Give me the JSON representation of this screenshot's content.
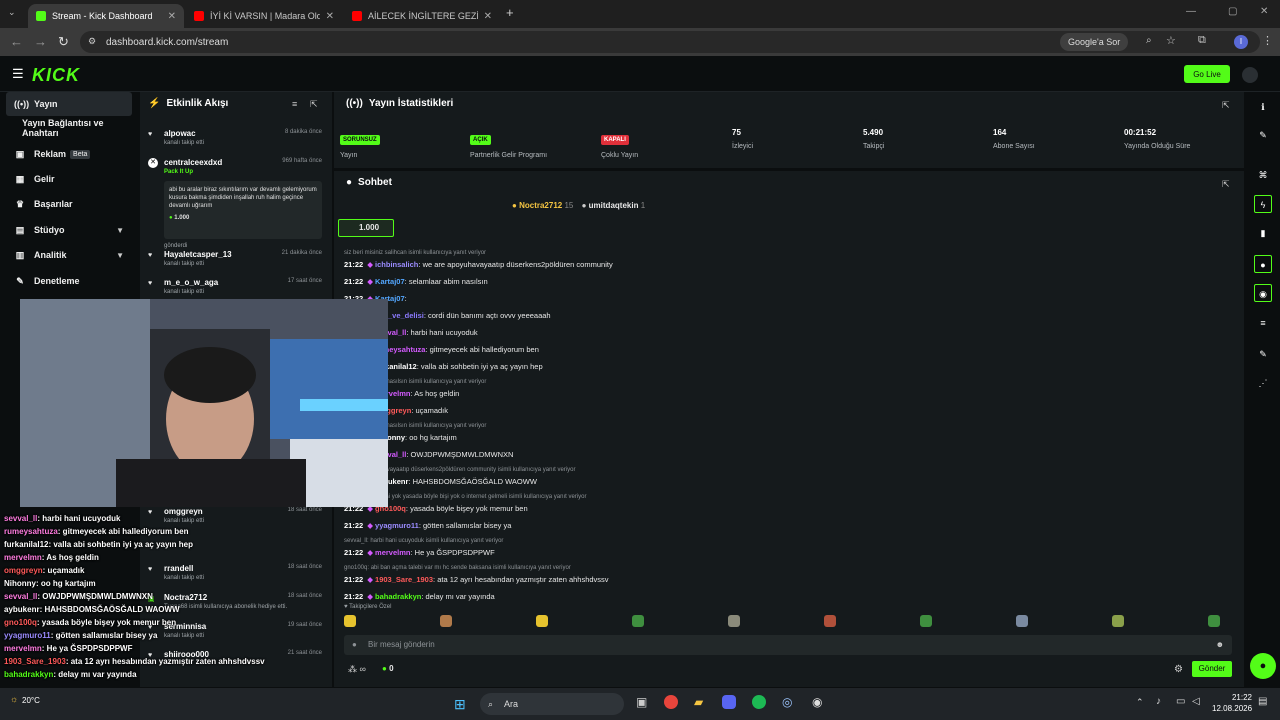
{
  "browser": {
    "tabs": [
      {
        "label": "Stream - Kick Dashboard",
        "active": true
      },
      {
        "label": "İYİ Kİ VARSIN | Madara Olduk #",
        "active": false
      },
      {
        "label": "AİLECEK İNGİLTERE GEZİSİ VLO",
        "active": false
      }
    ],
    "url": "dashboard.kick.com/stream",
    "google_label": "Google'a Sor",
    "profile_initial": "I"
  },
  "header": {
    "logo": "KICK",
    "go_live": "Go Live"
  },
  "sidebar": {
    "items": [
      {
        "label": "Yayın",
        "icon": "broadcast-icon",
        "active": true
      },
      {
        "label": "Yayın Bağlantısı ve Anahtarı",
        "icon": "",
        "active": false
      },
      {
        "label": "Reklam",
        "icon": "ad-icon",
        "beta": "Beta"
      },
      {
        "label": "Gelir",
        "icon": "revenue-icon"
      },
      {
        "label": "Başarılar",
        "icon": "trophy-icon"
      },
      {
        "label": "Stüdyo",
        "icon": "studio-icon",
        "chevron": true
      },
      {
        "label": "Analitik",
        "icon": "chart-icon",
        "chevron": true
      },
      {
        "label": "Denetleme",
        "icon": "wrench-icon"
      }
    ]
  },
  "activity": {
    "title": "Etkinlik Akışı",
    "items": [
      {
        "user": "alpowac",
        "time": "8 dakika önce",
        "sub": "kanalı takip etti"
      },
      {
        "user": "centralceexdxd",
        "time": "969 hafta önce",
        "sub": "Pack It Up",
        "message": "abi bu aralar biraz sıkıntılarım var devamlı gelemiyorum kusura bakma şimdiden inşallah ruh halim geçince devamlı uğrarım",
        "amount": "1.000",
        "footer": "gönderdi"
      },
      {
        "user": "Hayaletcasper_13",
        "time": "21 dakika önce",
        "sub": "kanalı takip etti"
      },
      {
        "user": "m_e_o_w_aga",
        "time": "17 saat önce",
        "sub": "kanalı takip etti"
      },
      {
        "user": "omggreyn",
        "time": "18 saat önce",
        "sub": "kanalı takip etti"
      },
      {
        "user": "rrandell",
        "time": "18 saat önce",
        "sub": "kanalı takip etti"
      },
      {
        "user": "Noctra2712",
        "time": "18 saat önce",
        "sub": "Tuana68 isimli kullanıcıya abonelik hediye etti."
      },
      {
        "user": "serminnisa",
        "time": "19 saat önce",
        "sub": "kanalı takip etti"
      },
      {
        "user": "shiirooo000",
        "time": "21 saat önce",
        "sub": ""
      }
    ]
  },
  "stats": {
    "title": "Yayın İstatistikleri",
    "cards": [
      {
        "badge": "SORUNSUZ",
        "badge_color": "#53fc18",
        "label": "Yayın"
      },
      {
        "badge": "AÇIK",
        "badge_color": "#53fc18",
        "label": "Partnerlik Gelir Programı"
      },
      {
        "badge": "KAPALI",
        "badge_color": "#e0303a",
        "label": "Çoklu Yayın"
      },
      {
        "value": "75",
        "label": "İzleyici"
      },
      {
        "value": "5.490",
        "label": "Takipçi"
      },
      {
        "value": "164",
        "label": "Abone Sayısı"
      },
      {
        "value": "00:21:52",
        "label": "Yayında Olduğu Süre"
      }
    ]
  },
  "chat": {
    "title": "Sohbet",
    "top_gifters": [
      {
        "name": "Noctra2712",
        "count": "15"
      },
      {
        "name": "umitdaqtekin",
        "count": "1"
      }
    ],
    "pinned_amount": "1.000",
    "lines": [
      {
        "reply": "siz beri misiniz salihcan isimli kullanıcıya yanıt veriyor"
      },
      {
        "time": "21:22",
        "user": "ichbinsalich",
        "color": "#9b8cff",
        "text": "we are apoyuhavayaatıp düserkens2pöldüren community"
      },
      {
        "time": "21:22",
        "user": "Kartaj07",
        "color": "#53a7ff",
        "text": "selamlaar abim nasılsın"
      },
      {
        "time": "21:22",
        "user": "Kartaj07",
        "color": "#53a7ff",
        "text": ""
      },
      {
        "time": "21:22",
        "user": "sen_ve_delisi",
        "color": "#8c7bff",
        "text": "cordi dün banımı açtı ovvv yeeeaaah"
      },
      {
        "time": "21:22",
        "user": "sevval_ll",
        "color": "#d45bff",
        "text": "harbi hani ucuyoduk"
      },
      {
        "time": "21:22",
        "user": "rumeysahtuza",
        "color": "#d45bff",
        "text": "gitmeyecek abi hallediyorum ben"
      },
      {
        "time": "21:22",
        "user": "furkanilal12",
        "color": "#ffffff",
        "text": "valla abi sohbetin iyi ya aç yayın hep"
      },
      {
        "reply": "selamlaar abim nasılsın isimli kullanıcıya yanıt veriyor"
      },
      {
        "time": "21:22",
        "user": "mervelmn",
        "color": "#d45bff",
        "text": "As hoş geldin"
      },
      {
        "time": "21:22",
        "user": "omggreyn",
        "color": "#ff5a5a",
        "text": "uçamadık"
      },
      {
        "reply": "selamlaar abim nasılsın isimli kullanıcıya yanıt veriyor"
      },
      {
        "time": "21:22",
        "user": "Nihonny",
        "color": "#ffffff",
        "text": "oo hg kartajım"
      },
      {
        "time": "21:22",
        "user": "sevval_ll",
        "color": "#d45bff",
        "text": "OWJDPWMŞDMWLDMWNXN"
      },
      {
        "reply": "we are apoyuhavayaatıp düserkens2pöldüren community isimli kullanıcıya yanıt veriyor"
      },
      {
        "time": "21:22",
        "user": "aybukenr",
        "color": "#ffffff",
        "text": "HAHSBDOMSĞAÖSĞALD WAOWW"
      },
      {
        "reply": "yasada böyle bişi yok yasada böyle bişi yok o internet gelmeli isimli kullanıcıya yanıt veriyor"
      },
      {
        "time": "21:22",
        "user": "gno100q",
        "color": "#ff5a5a",
        "text": "yasada böyle bişey yok memur ben"
      },
      {
        "time": "21:22",
        "user": "yyagmuro11",
        "color": "#9b8cff",
        "text": "götten sallamıslar bisey ya"
      },
      {
        "reply": "sevval_ll: harbi hani ucuyoduk isimli kullanıcıya yanıt veriyor"
      },
      {
        "time": "21:22",
        "user": "mervelmn",
        "color": "#d45bff",
        "text": "He ya ĞSPDPSDPPWF"
      },
      {
        "reply": "gno100q: abi ban açma talebi var mı hc sende baksana isimli kullanıcıya yanıt veriyor"
      },
      {
        "time": "21:22",
        "user": "1903_Sare_1903",
        "color": "#ff5a5a",
        "text": "ata 12 ayrı hesabından yazmıştır zaten ahhshdvssv"
      },
      {
        "time": "21:22",
        "user": "bahadrakkyn",
        "color": "#53fc18",
        "text": "delay mı var yayında"
      }
    ],
    "emote_label": "Takipçilere Özel",
    "input_placeholder": "Bir mesaj gönderin",
    "send_label": "Gönder",
    "points": "0"
  },
  "overlay_chat": [
    {
      "user": "sevval_ll",
      "color": "#ff7de0",
      "text": ": harbi hani ucuyoduk"
    },
    {
      "user": "rumeysahtuza",
      "color": "#ff7de0",
      "text": ": gitmeyecek abi hallediyorum ben"
    },
    {
      "user": "furkanilal12",
      "color": "#ffffff",
      "text": ": valla abi sohbetin iyi ya aç yayın hep"
    },
    {
      "user": "mervelmn",
      "color": "#ff7de0",
      "text": ": As hoş geldin"
    },
    {
      "user": "omggreyn",
      "color": "#ff5a5a",
      "text": ": uçamadık"
    },
    {
      "user": "Nihonny",
      "color": "#ffffff",
      "text": ": oo hg kartajım"
    },
    {
      "user": "sevval_ll",
      "color": "#ff7de0",
      "text": ": OWJDPWMŞDMWLDMWNXN"
    },
    {
      "user": "aybukenr",
      "color": "#ffffff",
      "text": ": HAHSBDOMSĞAÖSĞALD WAOWW"
    },
    {
      "user": "gno100q",
      "color": "#ff5a5a",
      "text": ": yasada böyle bişey yok memur ben"
    },
    {
      "user": "yyagmuro11",
      "color": "#9b8cff",
      "text": ": götten sallamıslar bisey ya"
    },
    {
      "user": "mervelmn",
      "color": "#ff7de0",
      "text": ": He ya ĞSPDPSDPPWF"
    },
    {
      "user": "1903_Sare_1903",
      "color": "#ff5a5a",
      "text": ": ata 12 ayrı hesabından yazmıştır zaten ahhshdvssv"
    },
    {
      "user": "bahadrakkyn",
      "color": "#53fc18",
      "text": ": delay mı var yayında"
    }
  ],
  "taskbar": {
    "search": "Ara",
    "time": "21:22",
    "date": "12.08.2026",
    "weather": "20°C"
  }
}
